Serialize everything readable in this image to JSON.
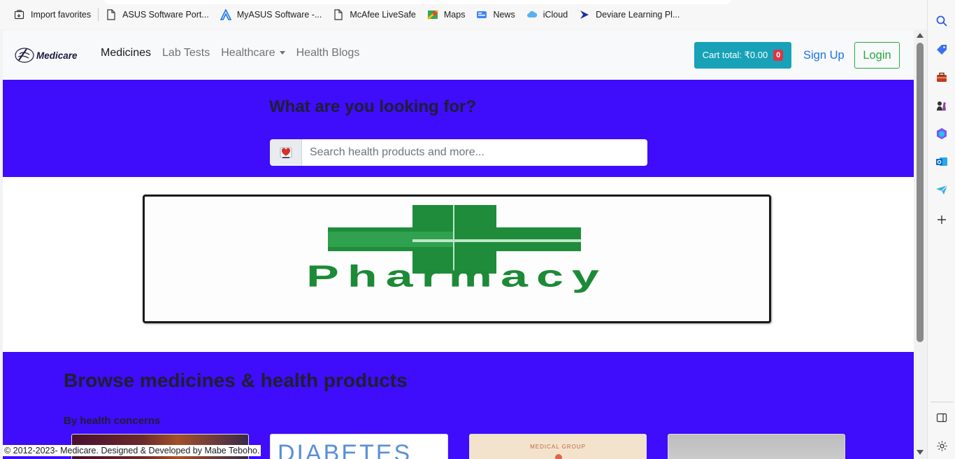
{
  "bookmarks": [
    {
      "label": "Import favorites",
      "icon": "import-icon"
    },
    {
      "label": "ASUS Software Port...",
      "icon": "page-icon"
    },
    {
      "label": "MyASUS Software -...",
      "icon": "asus-icon"
    },
    {
      "label": "McAfee LiveSafe",
      "icon": "page-icon"
    },
    {
      "label": "Maps",
      "icon": "maps-icon"
    },
    {
      "label": "News",
      "icon": "news-icon"
    },
    {
      "label": "iCloud",
      "icon": "cloud-icon"
    },
    {
      "label": "Deviare Learning Pl...",
      "icon": "deviare-icon"
    }
  ],
  "navbar": {
    "brand": "Medicare",
    "links": [
      "Medicines",
      "Lab Tests",
      "Healthcare",
      "Health Blogs"
    ],
    "cart_label": "Cart total: ₹0.00",
    "cart_count": "0",
    "signup": "Sign Up",
    "login": "Login"
  },
  "search": {
    "heading": "What are you looking for?",
    "placeholder": "Search health products and more..."
  },
  "banner": {
    "text": "Pharmacy"
  },
  "browse": {
    "title": "Browse medicines & health products",
    "subtitle": "By health concerns",
    "card2_text": "DIABETES",
    "card3_text": "MEDICAL GROUP"
  },
  "footer": {
    "text": "© 2012-2023- Medicare. Designed & Developed by Mabe Teboho."
  },
  "colors": {
    "band": "#3f0cfc",
    "cart": "#17a2b8",
    "badge": "#dc3545",
    "login": "#28a745",
    "signup": "#1a73e8",
    "banner_green": "#1c8a36"
  }
}
